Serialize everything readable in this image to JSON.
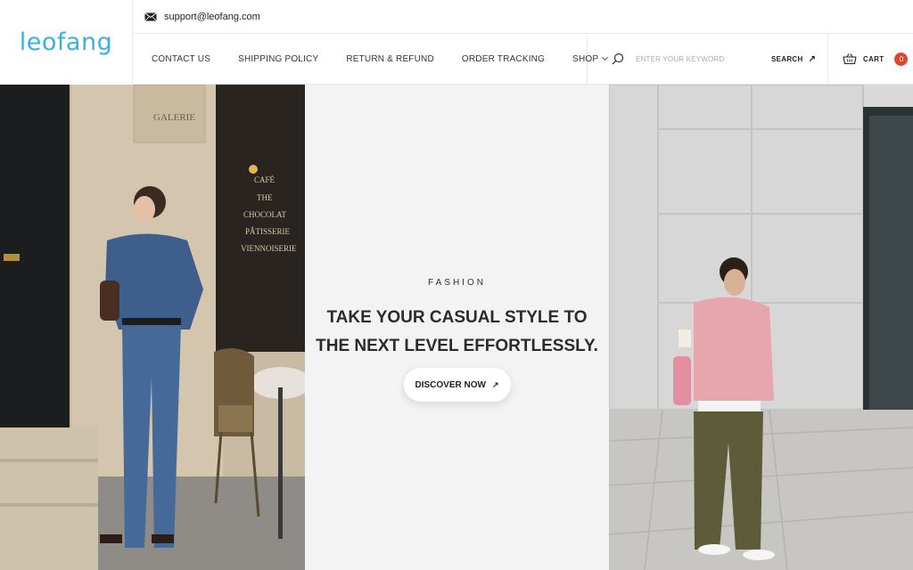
{
  "brand": {
    "logo_text": "leofang",
    "accent": "#3ab0e2"
  },
  "topbar": {
    "email": "support@leofang.com",
    "icon": "mail-icon"
  },
  "nav": {
    "items": [
      {
        "label": "CONTACT US"
      },
      {
        "label": "SHIPPING POLICY"
      },
      {
        "label": "RETURN & REFUND"
      },
      {
        "label": "ORDER TRACKING"
      },
      {
        "label": "SHOP"
      }
    ]
  },
  "search": {
    "placeholder": "ENTER YOUR KEYWORD",
    "button_label": "SEARCH",
    "icon": "search-icon",
    "button_icon": "arrow-up-right-icon"
  },
  "cart": {
    "label": "CART",
    "count": "0",
    "icon": "basket-icon",
    "badge_color": "#e2442f"
  },
  "hero": {
    "eyebrow": "FASHION",
    "headline": "TAKE YOUR CASUAL STYLE TO THE NEXT LEVEL EFFORTLESSLY.",
    "cta_label": "DISCOVER NOW",
    "cta_icon": "arrow-up-right-icon",
    "left_image": {
      "sign_galerie": "GALERIE",
      "window_lines": [
        "CAFÉ",
        "THE",
        "CHOCOLAT",
        "PÂTISSERIE",
        "VIENNOISERIE"
      ]
    }
  }
}
